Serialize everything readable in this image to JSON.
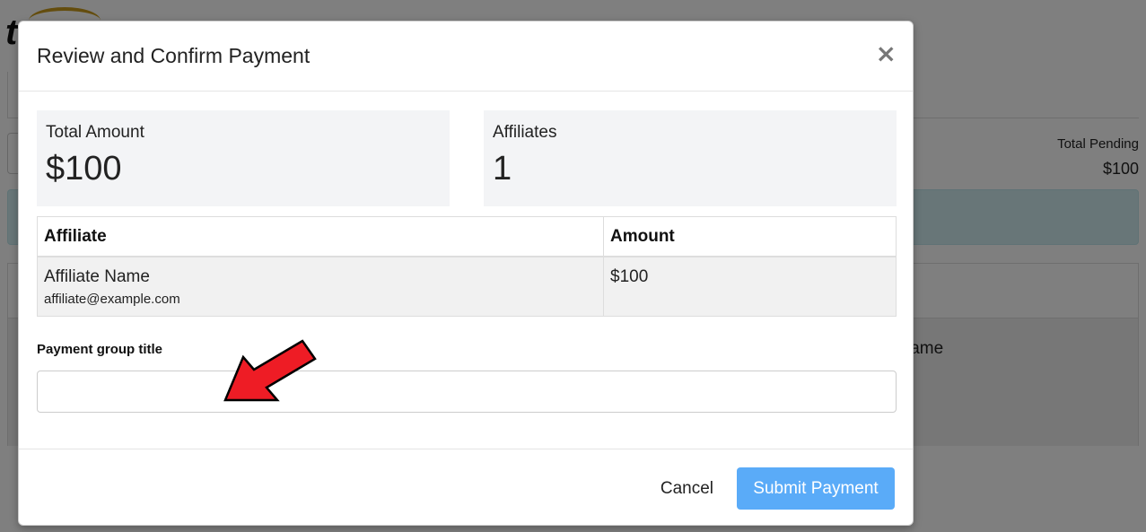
{
  "background": {
    "logo_letter": "t",
    "total_pending_label": "Total Pending",
    "total_pending_value": "$100",
    "partial_column_text": "lame"
  },
  "modal": {
    "title": "Review and Confirm Payment",
    "close_glyph": "×",
    "stats": [
      {
        "label": "Total Amount",
        "value": "$100"
      },
      {
        "label": "Affiliates",
        "value": "1"
      }
    ],
    "table": {
      "headers": [
        "Affiliate",
        "Amount"
      ],
      "rows": [
        {
          "name": "Affiliate Name",
          "email": "affiliate@example.com",
          "amount": "$100"
        }
      ]
    },
    "field": {
      "label": "Payment group title",
      "value": ""
    },
    "footer": {
      "cancel_label": "Cancel",
      "submit_label": "Submit Payment"
    }
  },
  "annotation": {
    "arrow_color": "#ee1c25"
  },
  "colors": {
    "submit_button": "#5aabf8",
    "stat_background": "#f3f4f6"
  }
}
